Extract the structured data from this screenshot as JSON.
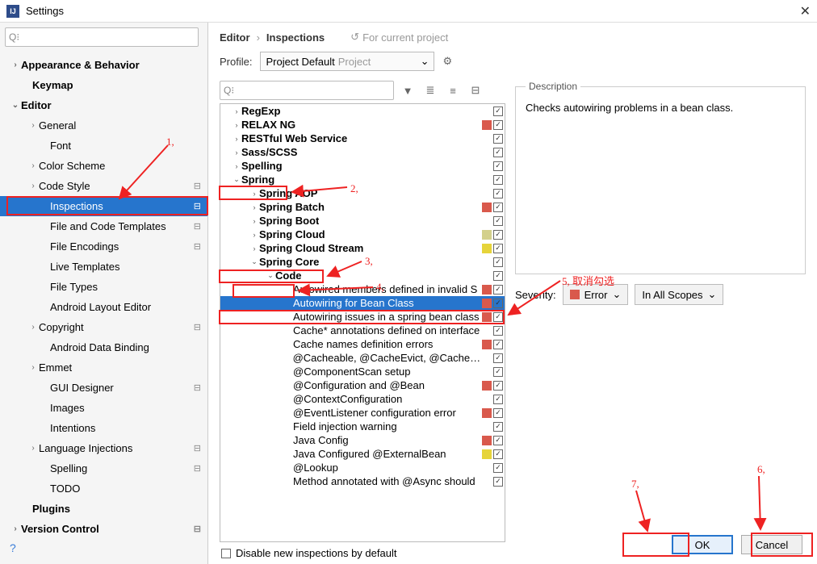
{
  "title": "Settings",
  "sidebar": {
    "items": [
      {
        "label": "Appearance & Behavior",
        "indent": 18,
        "arrow": "›",
        "bold": true,
        "gear": false
      },
      {
        "label": "Keymap",
        "indent": 32,
        "arrow": "",
        "bold": true,
        "gear": false
      },
      {
        "label": "Editor",
        "indent": 18,
        "arrow": "⌄",
        "bold": true,
        "gear": false
      },
      {
        "label": "General",
        "indent": 40,
        "arrow": "›",
        "bold": false,
        "gear": false
      },
      {
        "label": "Font",
        "indent": 54,
        "arrow": "",
        "bold": false,
        "gear": false
      },
      {
        "label": "Color Scheme",
        "indent": 40,
        "arrow": "›",
        "bold": false,
        "gear": false
      },
      {
        "label": "Code Style",
        "indent": 40,
        "arrow": "›",
        "bold": false,
        "gear": true
      },
      {
        "label": "Inspections",
        "indent": 54,
        "arrow": "",
        "bold": false,
        "gear": true,
        "selected": true
      },
      {
        "label": "File and Code Templates",
        "indent": 54,
        "arrow": "",
        "bold": false,
        "gear": true
      },
      {
        "label": "File Encodings",
        "indent": 54,
        "arrow": "",
        "bold": false,
        "gear": true
      },
      {
        "label": "Live Templates",
        "indent": 54,
        "arrow": "",
        "bold": false,
        "gear": false
      },
      {
        "label": "File Types",
        "indent": 54,
        "arrow": "",
        "bold": false,
        "gear": false
      },
      {
        "label": "Android Layout Editor",
        "indent": 54,
        "arrow": "",
        "bold": false,
        "gear": false
      },
      {
        "label": "Copyright",
        "indent": 40,
        "arrow": "›",
        "bold": false,
        "gear": true
      },
      {
        "label": "Android Data Binding",
        "indent": 54,
        "arrow": "",
        "bold": false,
        "gear": false
      },
      {
        "label": "Emmet",
        "indent": 40,
        "arrow": "›",
        "bold": false,
        "gear": false
      },
      {
        "label": "GUI Designer",
        "indent": 54,
        "arrow": "",
        "bold": false,
        "gear": true
      },
      {
        "label": "Images",
        "indent": 54,
        "arrow": "",
        "bold": false,
        "gear": false
      },
      {
        "label": "Intentions",
        "indent": 54,
        "arrow": "",
        "bold": false,
        "gear": false
      },
      {
        "label": "Language Injections",
        "indent": 40,
        "arrow": "›",
        "bold": false,
        "gear": true
      },
      {
        "label": "Spelling",
        "indent": 54,
        "arrow": "",
        "bold": false,
        "gear": true
      },
      {
        "label": "TODO",
        "indent": 54,
        "arrow": "",
        "bold": false,
        "gear": false
      },
      {
        "label": "Plugins",
        "indent": 32,
        "arrow": "",
        "bold": true,
        "gear": false
      },
      {
        "label": "Version Control",
        "indent": 18,
        "arrow": "›",
        "bold": true,
        "gear": true
      }
    ]
  },
  "breadcrumb": [
    "Editor",
    "Inspections"
  ],
  "reset_label": "For current project",
  "profile": {
    "label": "Profile:",
    "value": "Project Default",
    "scope": "Project"
  },
  "inspections": [
    {
      "label": "RegExp",
      "indent": 14,
      "arrow": "›",
      "bold": true,
      "sev": "",
      "check": "chk"
    },
    {
      "label": "RELAX NG",
      "indent": 14,
      "arrow": "›",
      "bold": true,
      "sev": "#d9594c",
      "check": "chk"
    },
    {
      "label": "RESTful Web Service",
      "indent": 14,
      "arrow": "›",
      "bold": true,
      "sev": "",
      "check": "chk"
    },
    {
      "label": "Sass/SCSS",
      "indent": 14,
      "arrow": "›",
      "bold": true,
      "sev": "",
      "check": "chk"
    },
    {
      "label": "Spelling",
      "indent": 14,
      "arrow": "›",
      "bold": true,
      "sev": "",
      "check": "chk"
    },
    {
      "label": "Spring",
      "indent": 14,
      "arrow": "⌄",
      "bold": true,
      "sev": "",
      "check": "chk"
    },
    {
      "label": "Spring AOP",
      "indent": 36,
      "arrow": "›",
      "bold": true,
      "sev": "",
      "check": "chk"
    },
    {
      "label": "Spring Batch",
      "indent": 36,
      "arrow": "›",
      "bold": true,
      "sev": "#d9594c",
      "check": "chk"
    },
    {
      "label": "Spring Boot",
      "indent": 36,
      "arrow": "›",
      "bold": true,
      "sev": "",
      "check": "chk"
    },
    {
      "label": "Spring Cloud",
      "indent": 36,
      "arrow": "›",
      "bold": true,
      "sev": "#d3d08b",
      "check": "chk"
    },
    {
      "label": "Spring Cloud Stream",
      "indent": 36,
      "arrow": "›",
      "bold": true,
      "sev": "#e6d43a",
      "check": "chk"
    },
    {
      "label": "Spring Core",
      "indent": 36,
      "arrow": "⌄",
      "bold": true,
      "sev": "",
      "check": "chk"
    },
    {
      "label": "Code",
      "indent": 56,
      "arrow": "⌄",
      "bold": true,
      "sev": "",
      "check": "chk"
    },
    {
      "label": "Autowired members defined in invalid S",
      "indent": 78,
      "arrow": "",
      "bold": false,
      "sev": "#d9594c",
      "check": "chk"
    },
    {
      "label": "Autowiring for Bean Class",
      "indent": 78,
      "arrow": "",
      "bold": false,
      "sev": "#d9594c",
      "check": "chk",
      "selected": true
    },
    {
      "label": "Autowiring issues in a spring bean class",
      "indent": 78,
      "arrow": "",
      "bold": false,
      "sev": "#d9594c",
      "check": "chk"
    },
    {
      "label": "Cache* annotations defined on interface",
      "indent": 78,
      "arrow": "",
      "bold": false,
      "sev": "",
      "check": "chk"
    },
    {
      "label": "Cache names definition errors",
      "indent": 78,
      "arrow": "",
      "bold": false,
      "sev": "#d9594c",
      "check": "chk"
    },
    {
      "label": "@Cacheable, @CacheEvict, @CachePut,",
      "indent": 78,
      "arrow": "",
      "bold": false,
      "sev": "",
      "check": "chk"
    },
    {
      "label": "@ComponentScan setup",
      "indent": 78,
      "arrow": "",
      "bold": false,
      "sev": "",
      "check": "chk"
    },
    {
      "label": "@Configuration and @Bean",
      "indent": 78,
      "arrow": "",
      "bold": false,
      "sev": "#d9594c",
      "check": "chk"
    },
    {
      "label": "@ContextConfiguration",
      "indent": 78,
      "arrow": "",
      "bold": false,
      "sev": "",
      "check": "chk"
    },
    {
      "label": "@EventListener configuration error",
      "indent": 78,
      "arrow": "",
      "bold": false,
      "sev": "#d9594c",
      "check": "chk"
    },
    {
      "label": "Field injection warning",
      "indent": 78,
      "arrow": "",
      "bold": false,
      "sev": "",
      "check": "chk"
    },
    {
      "label": "Java Config",
      "indent": 78,
      "arrow": "",
      "bold": false,
      "sev": "#d9594c",
      "check": "chk"
    },
    {
      "label": "Java Configured @ExternalBean",
      "indent": 78,
      "arrow": "",
      "bold": false,
      "sev": "#e6d43a",
      "check": "chk"
    },
    {
      "label": "@Lookup",
      "indent": 78,
      "arrow": "",
      "bold": false,
      "sev": "",
      "check": "chk"
    },
    {
      "label": "Method annotated with @Async should",
      "indent": 78,
      "arrow": "",
      "bold": false,
      "sev": "",
      "check": "chk"
    }
  ],
  "disable_label": "Disable new inspections by default",
  "desc": {
    "title": "Description",
    "body": "Checks autowiring problems in a bean class."
  },
  "severity": {
    "label": "Severity:",
    "value": "Error",
    "scope": "In All Scopes"
  },
  "buttons": {
    "ok": "OK",
    "cancel": "Cancel"
  },
  "annotations": {
    "a1": "1,",
    "a2": "2,",
    "a3": "3,",
    "a4": "4,",
    "a5": "5, 取消勾选",
    "a6": "6,",
    "a7": "7,"
  }
}
